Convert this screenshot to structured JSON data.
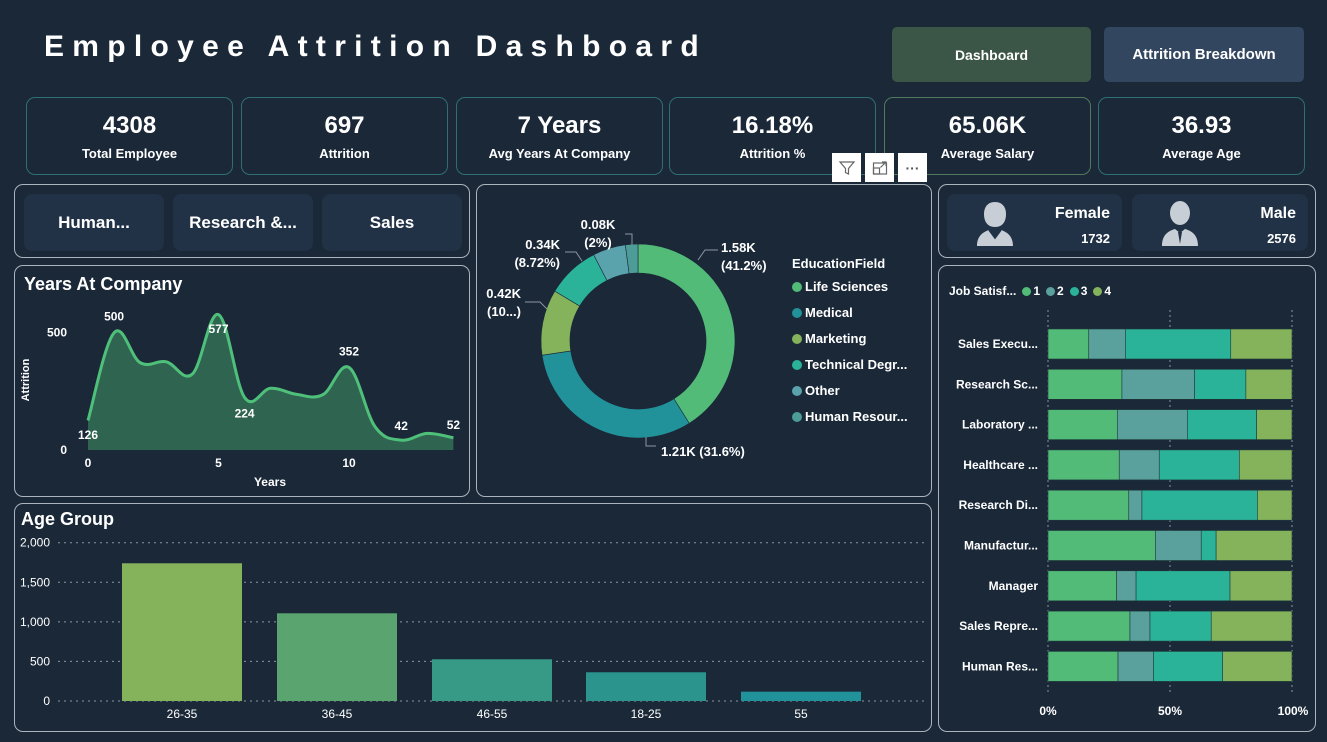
{
  "header": {
    "title": "Employee Attrition Dashboard",
    "nav": [
      {
        "label": "Dashboard",
        "active": true
      },
      {
        "label": "Attrition Breakdown",
        "active": false
      }
    ]
  },
  "kpis": [
    {
      "value": "4308",
      "label": "Total Employee"
    },
    {
      "value": "697",
      "label": "Attrition"
    },
    {
      "value": "7 Years",
      "label": "Avg Years At Company"
    },
    {
      "value": "16.18%",
      "label": "Attrition %"
    },
    {
      "value": "65.06K",
      "label": "Average Salary"
    },
    {
      "value": "36.93",
      "label": "Average Age"
    }
  ],
  "department_slicer": [
    "Human...",
    "Research &...",
    "Sales"
  ],
  "visual_toolbar": {
    "icons": [
      "filter-icon",
      "focus-mode-icon",
      "more-options-icon"
    ],
    "more_label": "···"
  },
  "gender": [
    {
      "label": "Female",
      "value": "1732",
      "icon": "female-user-icon"
    },
    {
      "label": "Male",
      "value": "2576",
      "icon": "male-user-icon"
    }
  ],
  "colors": {
    "background": "#1a2838",
    "area_line": "#4fc07a",
    "area_fill": "#2f6450",
    "js1": "#52bb78",
    "js2": "#5aa09c",
    "js3": "#2bb39a",
    "js4": "#84b35c"
  },
  "chart_data": [
    {
      "id": "years_at_company",
      "type": "area",
      "title": "Years At Company",
      "xlabel": "Years",
      "ylabel": "Attrition",
      "x": [
        0,
        1,
        2,
        3,
        4,
        5,
        6,
        7,
        8,
        9,
        10,
        11,
        12,
        13,
        14
      ],
      "values": [
        126,
        500,
        372,
        376,
        324,
        577,
        224,
        263,
        237,
        236,
        352,
        99,
        42,
        71,
        52
      ],
      "data_labels": [
        {
          "x": 0,
          "text": "126"
        },
        {
          "x": 1,
          "text": "500"
        },
        {
          "x": 5,
          "text": "577"
        },
        {
          "x": 6,
          "text": "224"
        },
        {
          "x": 10,
          "text": "352"
        },
        {
          "x": 12,
          "text": "42"
        },
        {
          "x": 14,
          "text": "52"
        }
      ],
      "xticks": [
        0,
        5,
        10
      ],
      "yticks": [
        0,
        500
      ],
      "ylim": [
        0,
        620
      ],
      "xlim": [
        0,
        14
      ],
      "grid": false
    },
    {
      "id": "education_field",
      "type": "pie",
      "donut": true,
      "legend_title": "EducationField",
      "legend_position": "right",
      "slices": [
        {
          "name": "Life Sciences",
          "legend_label": "Life Sciences",
          "value": 1.58,
          "pct": 41.2,
          "label": "1.58K\n(41.2%)",
          "color": "#52bb78"
        },
        {
          "name": "Medical",
          "legend_label": "Medical",
          "value": 1.21,
          "pct": 31.6,
          "label": "1.21K (31.6%)",
          "color": "#21919a"
        },
        {
          "name": "Marketing",
          "legend_label": "Marketing",
          "value": 0.42,
          "pct": 10.9,
          "label": "0.42K\n(10...)",
          "color": "#84b35c"
        },
        {
          "name": "Technical Degree",
          "legend_label": "Technical Degr...",
          "value": 0.34,
          "pct": 8.72,
          "label": "0.34K\n(8.72%)",
          "color": "#2bb39a"
        },
        {
          "name": "Other",
          "legend_label": "Other",
          "value": 0.21,
          "pct": 5.5,
          "label": "",
          "color": "#5aa3ac"
        },
        {
          "name": "Human Resources",
          "legend_label": "Human Resour...",
          "value": 0.08,
          "pct": 2,
          "label": "0.08K\n(2%)",
          "color": "#4d9c98"
        }
      ]
    },
    {
      "id": "job_satisfaction",
      "type": "bar",
      "orientation": "horizontal",
      "stacked": "100%",
      "legend_title": "Job Satisf...",
      "legend_position": "top-left",
      "series_names": [
        "1",
        "2",
        "3",
        "4"
      ],
      "categories": [
        "Sales Execu...",
        "Research Sc...",
        "Laboratory ...",
        "Healthcare ...",
        "Research Di...",
        "Manufactur...",
        "Manager",
        "Sales Repre...",
        "Human Res..."
      ],
      "series": [
        {
          "name": "1",
          "values": [
            16.7,
            30.3,
            28.4,
            29.2,
            33.1,
            44.0,
            28.1,
            33.6,
            28.7
          ]
        },
        {
          "name": "2",
          "values": [
            15.0,
            29.8,
            28.7,
            16.4,
            5.4,
            18.8,
            8.0,
            8.2,
            14.5
          ]
        },
        {
          "name": "3",
          "values": [
            43.2,
            21.0,
            28.4,
            32.8,
            47.3,
            6.1,
            38.5,
            25.1,
            28.4
          ]
        },
        {
          "name": "4",
          "values": [
            25.1,
            18.9,
            14.5,
            21.6,
            14.2,
            31.1,
            25.4,
            33.1,
            28.4
          ]
        }
      ],
      "xticks": [
        "0%",
        "50%",
        "100%"
      ],
      "xlim": [
        0,
        100
      ],
      "grid": true
    },
    {
      "id": "age_group",
      "type": "bar",
      "title": "Age Group",
      "categories": [
        "26-35",
        "36-45",
        "46-55",
        "18-25",
        "55"
      ],
      "values": [
        1740,
        1108,
        527,
        363,
        118
      ],
      "colors": [
        "#84b35c",
        "#5aa56f",
        "#379a86",
        "#2b948c",
        "#21919a"
      ],
      "yticks": [
        "0",
        "500",
        "1,000",
        "1,500",
        "2,000"
      ],
      "ylim": [
        0,
        2000
      ],
      "grid": true
    }
  ]
}
